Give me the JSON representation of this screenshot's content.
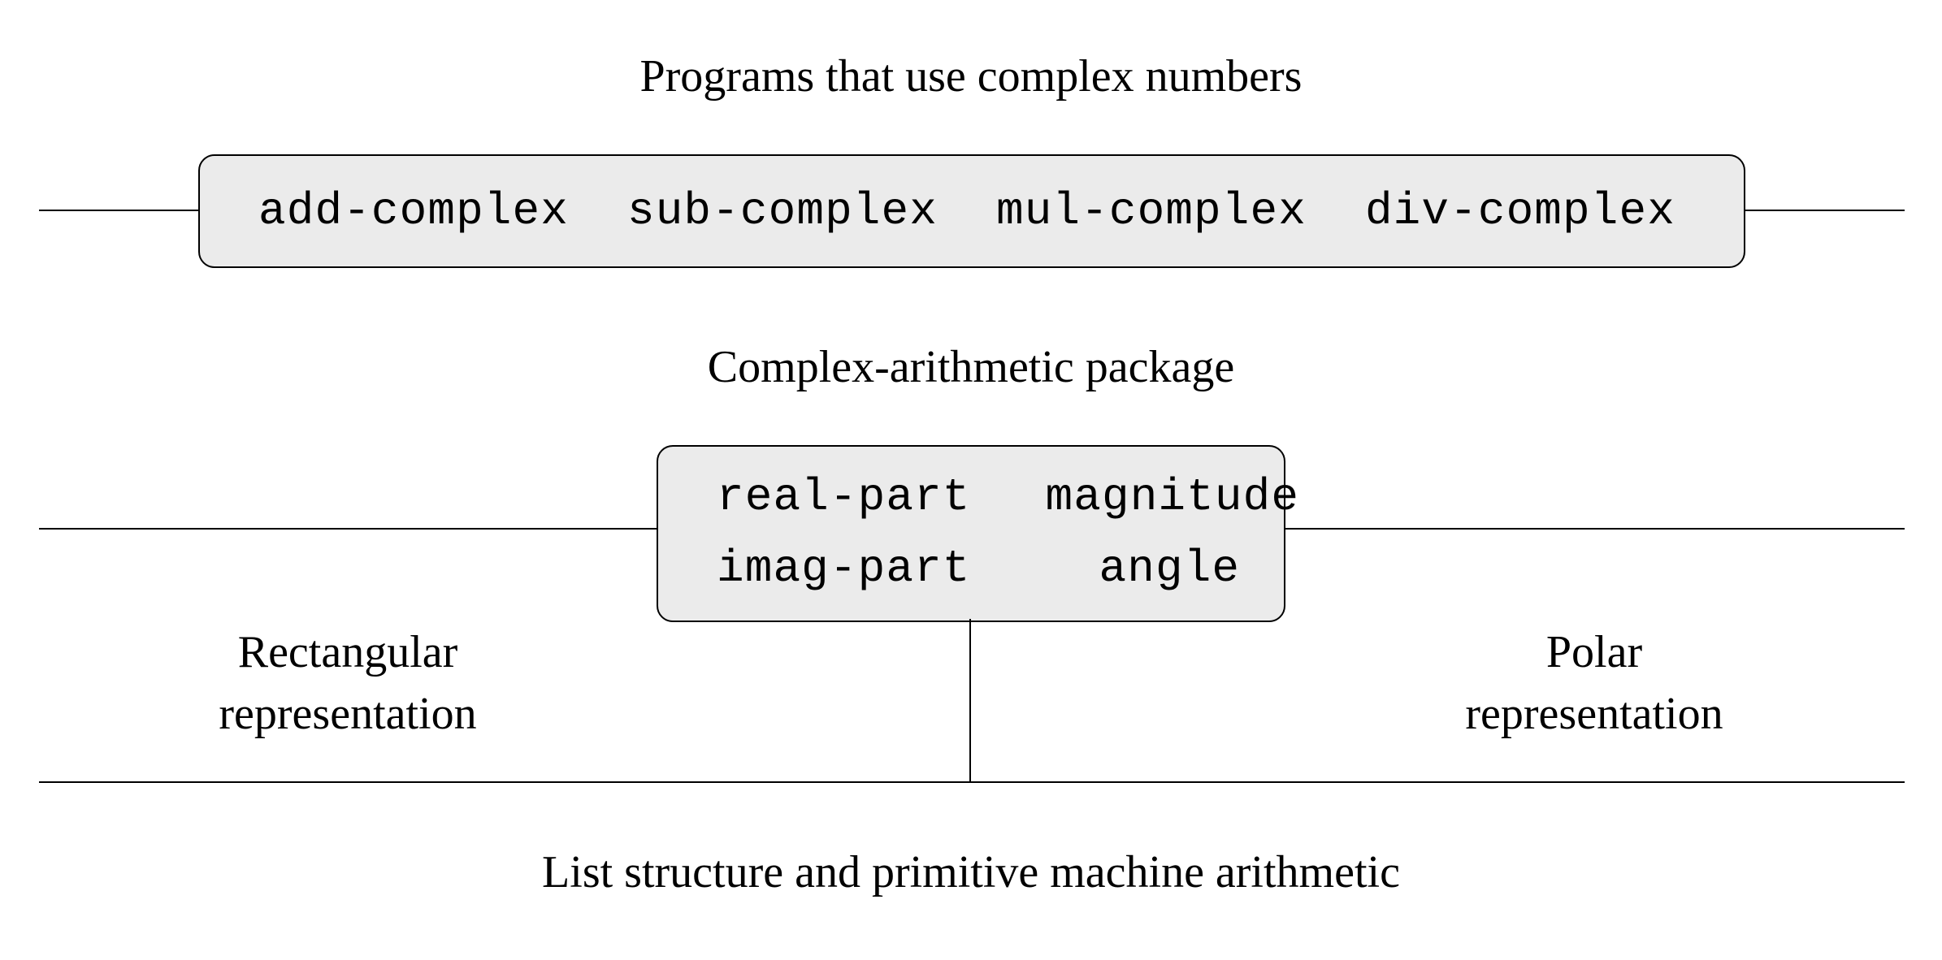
{
  "layers": {
    "top_label": "Programs that use complex numbers",
    "middle_label": "Complex-arithmetic package",
    "bottom_label": "List structure and primitive machine arithmetic"
  },
  "box1": {
    "ops": [
      "add-complex",
      "sub-complex",
      "mul-complex",
      "div-complex"
    ]
  },
  "box2": {
    "row1": [
      "real-part",
      "magnitude"
    ],
    "row2": [
      "imag-part",
      "angle"
    ]
  },
  "reps": {
    "left_line1": "Rectangular",
    "left_line2": "representation",
    "right_line1": "Polar",
    "right_line2": "representation"
  }
}
